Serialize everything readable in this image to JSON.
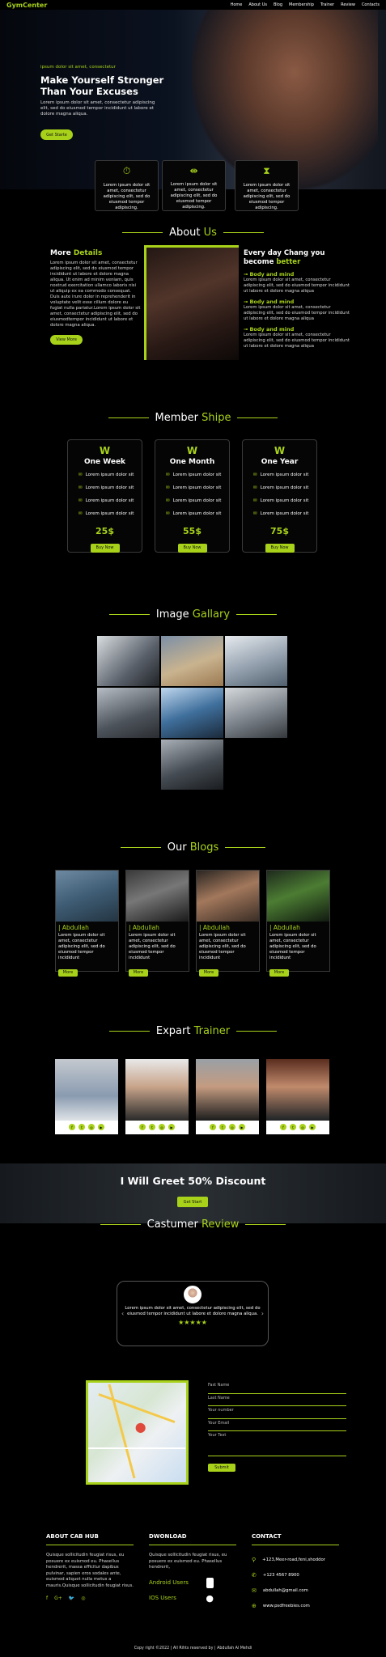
{
  "nav": {
    "logo": "GymCenter",
    "items": [
      "Home",
      "About Us",
      "Blog",
      "Membership",
      "Trainer",
      "Review",
      "Contacts"
    ]
  },
  "hero": {
    "tagline": "ipsum dolor sit amet, consectetur",
    "title": "Make Yourself Stronger Than Your Excuses",
    "text": "Lorem ipsum dolor sit amet, consectetur adipiscing elit, sed do eiusmod tempor incididunt ut labore et dolore magna aliqua.",
    "button": "Get Starte"
  },
  "features": [
    {
      "icon": "stopwatch-icon",
      "glyph": "⏱",
      "text": "Lorem ipsum dolor sit amet, consectetur adipiscing elit, sed do eiusmod tempor adipiscing."
    },
    {
      "icon": "dumbbell-icon",
      "glyph": "⇼",
      "text": "Lorem ipsum dolor sit amet, consectetur adipiscing elit, sed do eiusmod tempor adipiscing."
    },
    {
      "icon": "hourglass-icon",
      "glyph": "⧗",
      "text": "Lorem ipsum dolor sit amet, consectetur adipiscing elit, sed do eiusmod tempor adipiscing."
    }
  ],
  "about": {
    "title_a": "About",
    "title_b": "Us",
    "heading_a": "More",
    "heading_b": "Details",
    "text": "Lorem ipsum dolor sit amet, consectetur adipiscing elit, sed do eiusmod tempor incididunt ut labore et dolore magna aliqua. Ut enim ad minim veniam, quis nostrud exercitation ullamco laboris nisi ut aliquip ex ea commodo consequat. Duis aute irure dolor in reprehenderit in voluptate velit esse cillum dolore eu fugiat nulla pariatur.Lorem ipsum dolor sit amet, consectetur adipiscing elit, sed do eiusmodtempor incididunt ut labore et dolore magna aliqua.",
    "button": "View More",
    "right_heading_a": "Every day Chang you become",
    "right_heading_b": "better",
    "points": [
      {
        "title": "Body and mind",
        "text": "Lorem ipsum dolor sit amet, consectetur adipiscing elit, sed do eiusmod tempor incididunt ut labore et dolore magna aliqua"
      },
      {
        "title": "Body and mind",
        "text": "Lorem ipsum dolor sit amet, consectetur adipiscing elit, sed do eiusmod tempor incididunt ut labore et dolore magna aliqua"
      },
      {
        "title": "Body and mind",
        "text": "Lorem ipsum dolor sit amet, consectetur adipiscing elit, sed do eiusmod tempor incididunt ut labore et dolore magna aliqua"
      }
    ]
  },
  "membership": {
    "title_a": "Member",
    "title_b": "Shipe",
    "plans": [
      {
        "name": "One Week",
        "items": [
          "Lorem ipsum dolor sit",
          "Lorem ipsum dolor sit",
          "Lorem ipsum dolor sit",
          "Lorem ipsum dolor sit"
        ],
        "price": "25$",
        "button": "Buy Now"
      },
      {
        "name": "One Month",
        "items": [
          "Lorem ipsum dolor sit",
          "Lorem ipsum dolor sit",
          "Lorem ipsum dolor sit",
          "Lorem ipsum dolor sit"
        ],
        "price": "55$",
        "button": "Buy Now"
      },
      {
        "name": "One Year",
        "items": [
          "Lorem ipsum dolor sit",
          "Lorem ipsum dolor sit",
          "Lorem ipsum dolor sit",
          "Lorem ipsum dolor sit"
        ],
        "price": "75$",
        "button": "Buy Now"
      }
    ]
  },
  "gallery": {
    "title_a": "Image",
    "title_b": "Gallary"
  },
  "blogs": {
    "title_a": "Our",
    "title_b": "Blogs",
    "items": [
      {
        "author": "| Abdullah",
        "text": "Lorem ipsum dolor sit amet, consectetur adipiscing elit, sed do eiusmod tempor incididunt",
        "button": "More"
      },
      {
        "author": "| Abdullah",
        "text": "Lorem ipsum dolor sit amet, consectetur adipiscing elit, sed do eiusmod tempor incididunt",
        "button": "More"
      },
      {
        "author": "| Abdullah",
        "text": "Lorem ipsum dolor sit amet, consectetur adipiscing elit, sed do eiusmod tempor incididunt",
        "button": "More"
      },
      {
        "author": "| Abdullah",
        "text": "Lorem ipsum dolor sit amet, consectetur adipiscing elit, sed do eiusmod tempor incididunt",
        "button": "More"
      }
    ]
  },
  "trainers": {
    "title_a": "Expart",
    "title_b": "Trainer",
    "social": [
      "f",
      "t",
      "◎",
      "▶"
    ]
  },
  "discount": {
    "title": "I Will Greet 50% Discount",
    "button": "Get Start"
  },
  "review": {
    "title_a": "Castumer",
    "title_b": "Review",
    "text": "Lorem ipsum dolor sit amet, consectetur adipiscing elit, sed do eiusmod tempor incididunt ut labore et dolore magna aliqua.",
    "stars": "★★★★★"
  },
  "form": {
    "fields": [
      "Fast Name",
      "Last Name",
      "Your number",
      "Your Email",
      "Your Text"
    ],
    "button": "Submit"
  },
  "footer": {
    "about": {
      "title": "ABOUT CAB HUB",
      "text": "Quisque sollicitudin feugiat risus, eu posuere ex euismod eu. Phasellus hendrerit, massa efficitur dapibus pulvinar, sapien eros sodales ante, euismod aliquet nulla metus a mauris.Quisque sollicitudin feugiat risus.",
      "social": [
        "f",
        "G+",
        "🐦",
        "◎"
      ]
    },
    "download": {
      "title": "DWONLOAD",
      "text": "Quisque sollicitudin feugiat risus, eu posuere ex euismod eu. Phasellus hendrerit,",
      "android": "Android Users",
      "ios": "IOS Users"
    },
    "contact": {
      "title": "CONTACT",
      "items": [
        {
          "icon": "location-icon",
          "glyph": "⚲",
          "text": "+123,Meer-road,feni,shoddor"
        },
        {
          "icon": "phone-icon",
          "glyph": "✆",
          "text": "+123 4567 8900"
        },
        {
          "icon": "mail-icon",
          "glyph": "✉",
          "text": "abdullah@gmail.com"
        },
        {
          "icon": "globe-icon",
          "glyph": "⊕",
          "text": "www.psdfreebies.com"
        }
      ]
    },
    "copyright": "Copy right ©2022 | All Rihts reserved by | Abdullah Al Mehdi"
  },
  "colors": {
    "accent": "#a8d21a",
    "background": "#000000"
  }
}
